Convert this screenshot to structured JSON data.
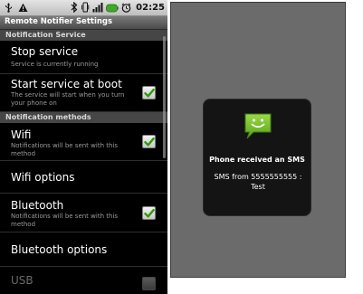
{
  "status_bar": {
    "time": "02:25",
    "left_icons": [
      "usb-icon",
      "warning-icon"
    ],
    "right_icons": [
      "bluetooth-icon",
      "vibrate-icon",
      "signal-icon",
      "battery-icon",
      "alarm-icon"
    ]
  },
  "app": {
    "title": "Remote Notifier Settings"
  },
  "categories": {
    "service": "Notification Service",
    "methods": "Notification methods"
  },
  "prefs": {
    "stop_service": {
      "title": "Stop service",
      "summary": "Service is currently running"
    },
    "start_at_boot": {
      "title": "Start service at boot",
      "summary": "The service will start when you turn your phone on",
      "checked": true
    },
    "wifi": {
      "title": "Wifi",
      "summary": "Notifications will be sent with this method",
      "checked": true
    },
    "wifi_options": {
      "title": "Wifi options"
    },
    "bluetooth": {
      "title": "Bluetooth",
      "summary": "Notifications will be sent with this method",
      "checked": true
    },
    "bluetooth_options": {
      "title": "Bluetooth options"
    },
    "usb": {
      "title": "USB",
      "checked": false,
      "enabled": false
    }
  },
  "notification": {
    "icon": "sms-icon",
    "title": "Phone received an SMS",
    "body": "SMS from 5555555555 : Test"
  },
  "colors": {
    "checkmark": "#2f9c0a",
    "category_bg": "#464646",
    "sms_icon": "#7cc42a"
  }
}
